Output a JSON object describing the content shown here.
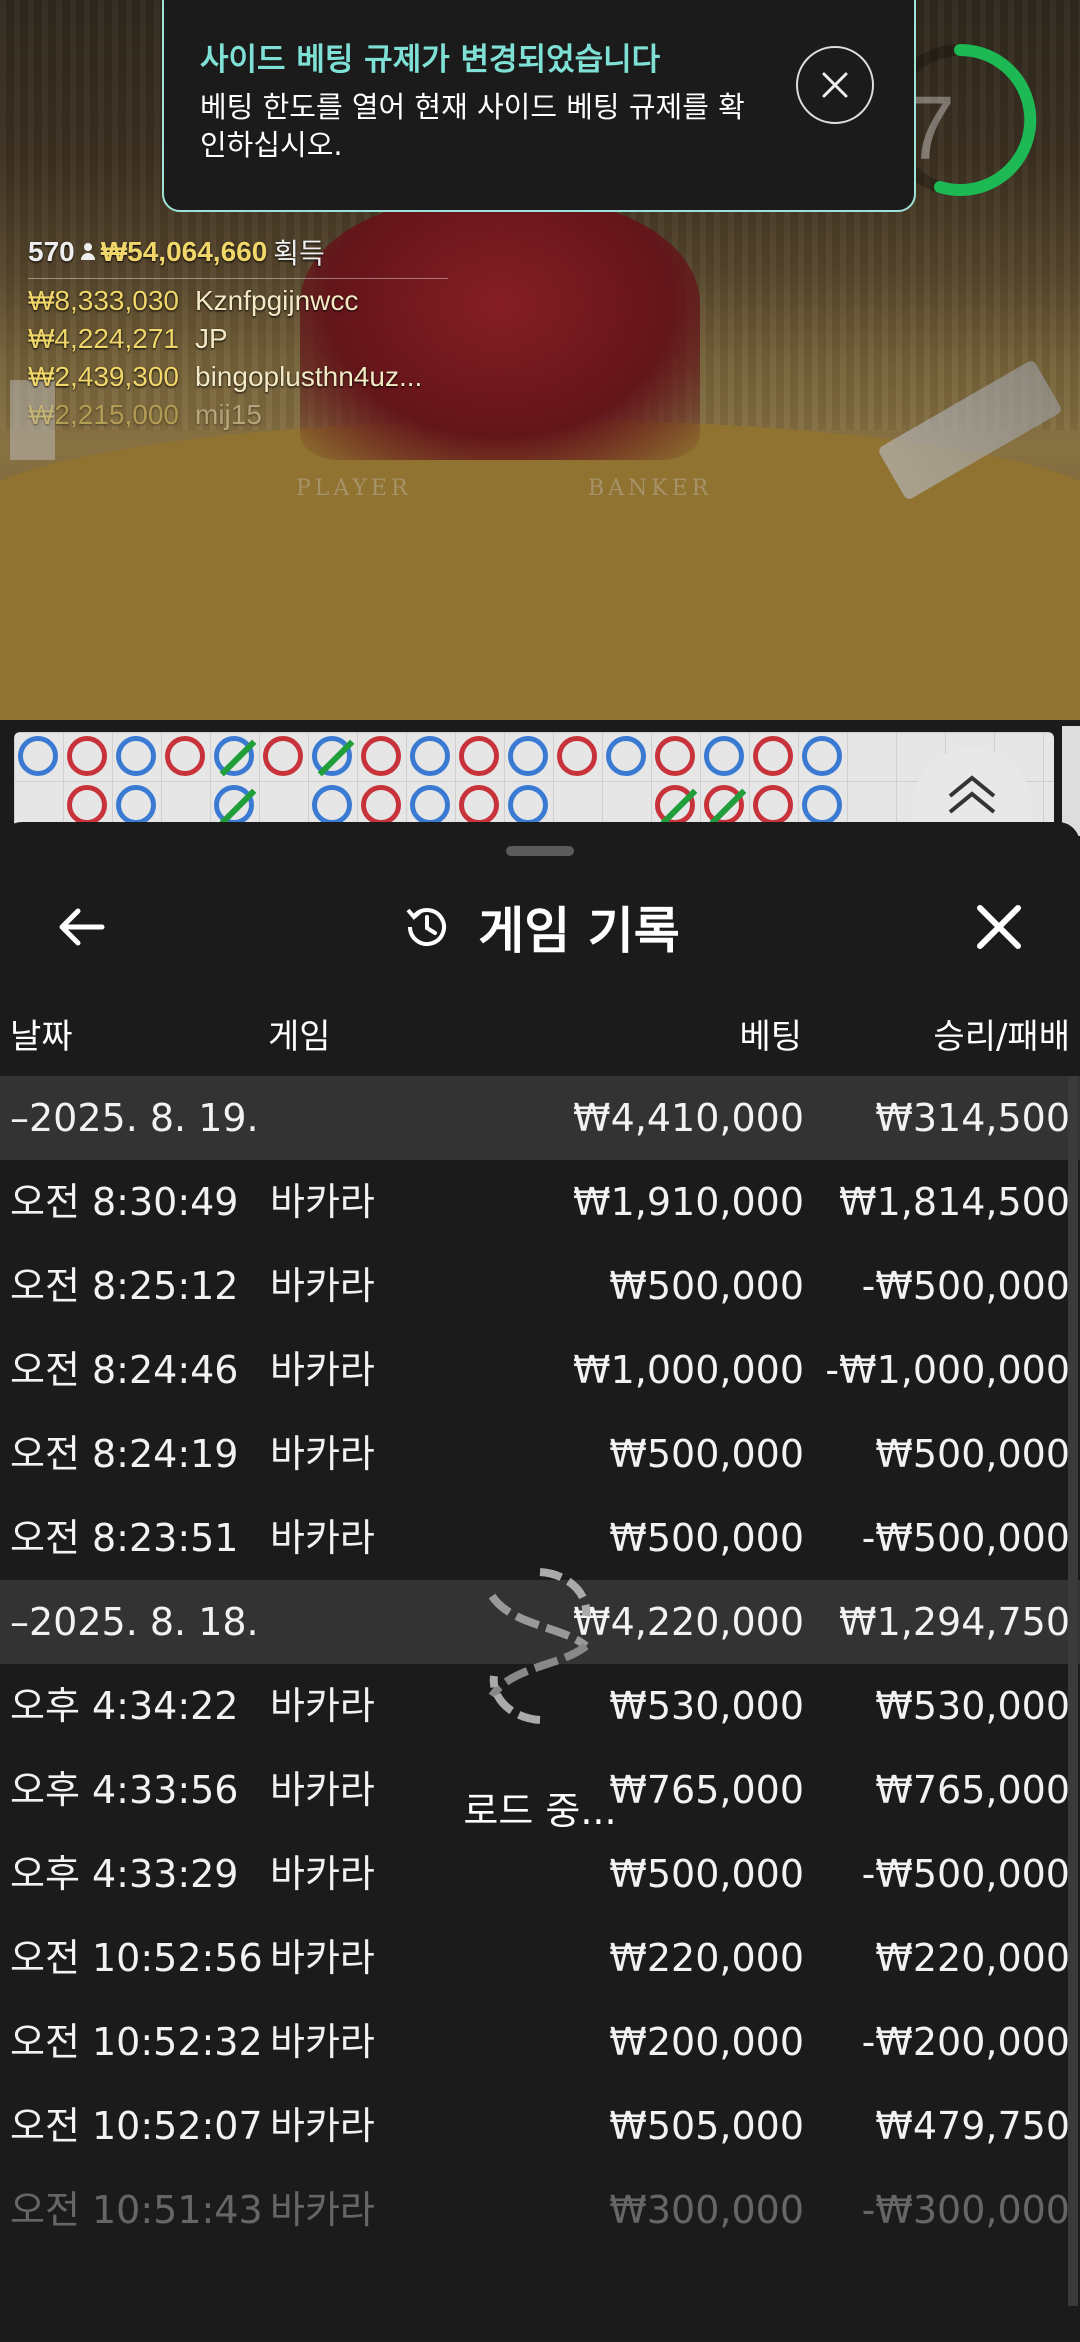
{
  "toast": {
    "title": "사이드 베팅 규제가 변경되었습니다",
    "message": "베팅 한도를 열어 현재 사이드 베팅 규제를 확인하십시오."
  },
  "jackpot": {
    "players": "570",
    "amount": "₩54,064,660",
    "label": "획득",
    "winners": [
      {
        "amount": "₩8,333,030",
        "name": "Kznfpgijnwcc"
      },
      {
        "amount": "₩4,224,271",
        "name": "JP"
      },
      {
        "amount": "₩2,439,300",
        "name": "bingoplusthn4uz..."
      },
      {
        "amount": "₩2,215,000",
        "name": "mij15"
      }
    ]
  },
  "timer": {
    "value": "7"
  },
  "table": {
    "player_label": "PLAYER",
    "banker_label": "BANKER"
  },
  "roadmap": {
    "top_row": [
      "b",
      "r",
      "b",
      "r",
      "b-tie",
      "r",
      "b-tie",
      "r",
      "b",
      "r",
      "b",
      "r",
      "b",
      "r",
      "b",
      "r",
      "b"
    ],
    "bottom_row": [
      "",
      "r",
      "b",
      "",
      "b-tie",
      "",
      "b",
      "r",
      "b",
      "r",
      "b",
      "",
      "",
      "r-tie",
      "r-tie",
      "r",
      "b"
    ]
  },
  "sheet": {
    "title": "게임 기록",
    "columns": {
      "date": "날짜",
      "game": "게임",
      "bet": "베팅",
      "result": "승리/패배"
    },
    "loading_text": "로드 중..."
  },
  "ledger": [
    {
      "type": "date",
      "date": "–2025. 8. 19.",
      "game": "",
      "bet": "₩4,410,000",
      "result": "₩314,500"
    },
    {
      "type": "entry",
      "date": "오전 8:30:49",
      "game": "바카라",
      "bet": "₩1,910,000",
      "result": "₩1,814,500"
    },
    {
      "type": "entry",
      "date": "오전 8:25:12",
      "game": "바카라",
      "bet": "₩500,000",
      "result": "-₩500,000"
    },
    {
      "type": "entry",
      "date": "오전 8:24:46",
      "game": "바카라",
      "bet": "₩1,000,000",
      "result": "-₩1,000,000"
    },
    {
      "type": "entry",
      "date": "오전 8:24:19",
      "game": "바카라",
      "bet": "₩500,000",
      "result": "₩500,000"
    },
    {
      "type": "entry",
      "date": "오전 8:23:51",
      "game": "바카라",
      "bet": "₩500,000",
      "result": "-₩500,000"
    },
    {
      "type": "date",
      "date": "–2025. 8. 18.",
      "game": "",
      "bet": "₩4,220,000",
      "result": "₩1,294,750"
    },
    {
      "type": "entry",
      "date": "오후 4:34:22",
      "game": "바카라",
      "bet": "₩530,000",
      "result": "₩530,000"
    },
    {
      "type": "entry",
      "date": "오후 4:33:56",
      "game": "바카라",
      "bet": "₩765,000",
      "result": "₩765,000"
    },
    {
      "type": "entry",
      "date": "오후 4:33:29",
      "game": "바카라",
      "bet": "₩500,000",
      "result": "-₩500,000"
    },
    {
      "type": "entry",
      "date": "오전 10:52:56",
      "game": "바카라",
      "bet": "₩220,000",
      "result": "₩220,000"
    },
    {
      "type": "entry",
      "date": "오전 10:52:32",
      "game": "바카라",
      "bet": "₩200,000",
      "result": "-₩200,000"
    },
    {
      "type": "entry",
      "date": "오전 10:52:07",
      "game": "바카라",
      "bet": "₩505,000",
      "result": "₩479,750"
    },
    {
      "type": "entry",
      "date": "오전 10:51:43",
      "game": "바카라",
      "bet": "₩300,000",
      "result": "-₩300,000"
    }
  ]
}
